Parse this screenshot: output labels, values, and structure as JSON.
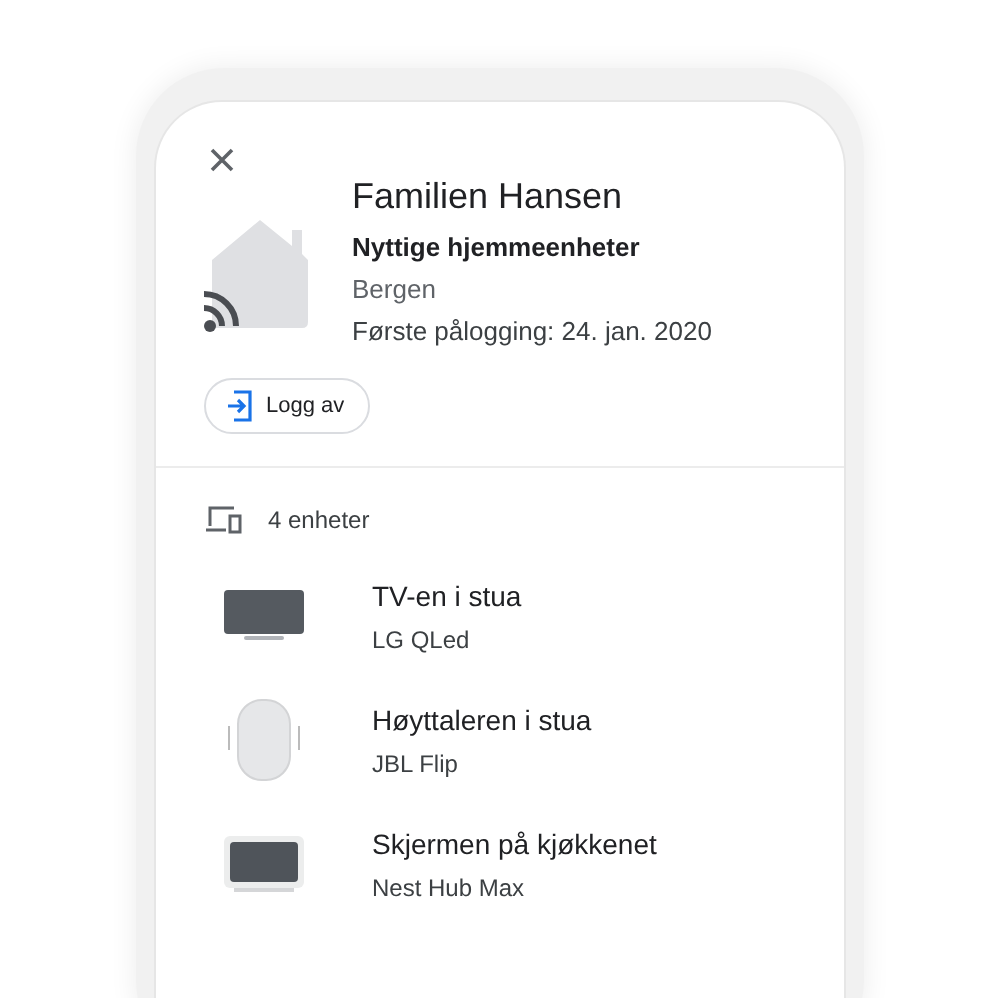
{
  "home": {
    "name": "Familien Hansen",
    "subtitle": "Nyttige hjemmeenheter",
    "location": "Bergen",
    "first_login": "Første pålogging: 24. jan. 2020",
    "logout_button": "Logg av"
  },
  "devices": {
    "count": "4 enheter",
    "items": [
      {
        "kind": "tv",
        "name": "TV-en i stua",
        "model": "LG QLed"
      },
      {
        "kind": "speaker",
        "name": "Høyttaleren i stua",
        "model": "JBL Flip"
      },
      {
        "kind": "display",
        "name": "Skjermen på kjøkkenet",
        "model": "Nest Hub Max"
      }
    ]
  }
}
